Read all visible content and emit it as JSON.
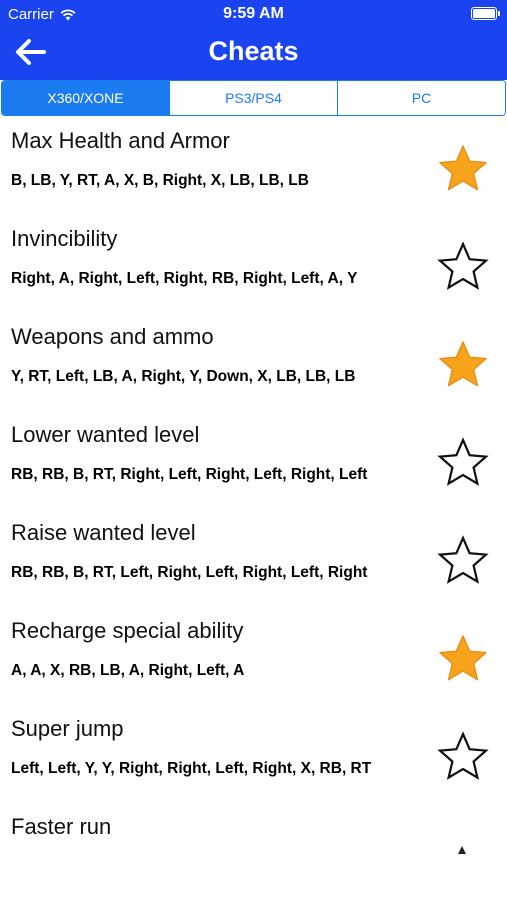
{
  "status_bar": {
    "carrier": "Carrier",
    "time": "9:59 AM"
  },
  "nav": {
    "title": "Cheats",
    "back_icon": "arrow-left-icon"
  },
  "platform_tabs": [
    {
      "label": "X360/XONE",
      "active": true
    },
    {
      "label": "PS3/PS4",
      "active": false
    },
    {
      "label": "PC",
      "active": false
    }
  ],
  "colors": {
    "header_blue": "#1a44f0",
    "tab_blue": "#1a7cf0",
    "star_gold": "#f7a31b"
  },
  "cheats": [
    {
      "title": "Max Health and Armor",
      "code": "B, LB, Y, RT, A, X, B, Right, X, LB, LB, LB",
      "favorite": true
    },
    {
      "title": "Invincibility",
      "code": "Right, A, Right, Left, Right, RB, Right, Left, A, Y",
      "favorite": false
    },
    {
      "title": "Weapons and ammo",
      "code": "Y, RT, Left, LB, A, Right, Y, Down, X, LB, LB, LB",
      "favorite": true
    },
    {
      "title": "Lower wanted level",
      "code": "RB, RB, B, RT, Right, Left, Right, Left, Right, Left",
      "favorite": false
    },
    {
      "title": "Raise wanted level",
      "code": "RB, RB, B, RT, Left, Right, Left, Right, Left, Right",
      "favorite": false
    },
    {
      "title": "Recharge special ability",
      "code": "A, A, X, RB, LB, A, Right, Left, A",
      "favorite": true
    },
    {
      "title": "Super jump",
      "code": "Left, Left, Y, Y, Right, Right, Left, Right, X, RB, RT",
      "favorite": false
    },
    {
      "title": "Faster run",
      "code": "",
      "favorite": null
    }
  ]
}
